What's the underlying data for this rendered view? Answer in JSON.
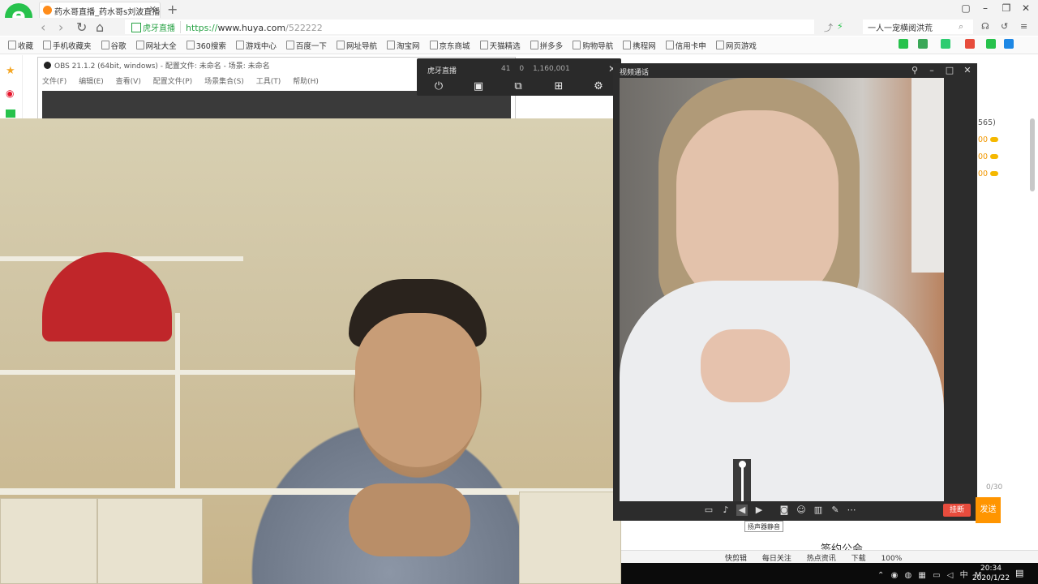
{
  "browser": {
    "tab_title": "药水哥直播_药水哥s刘波直播间",
    "tab_close": "✕",
    "new_tab": "+",
    "url_site_label": "虎牙直播",
    "url_protocol": "https://",
    "url_host": "www.huya.com",
    "url_path": "/522222",
    "search_text": "一人一宠横阅洪荒",
    "bookmarks": [
      "收藏",
      "手机收藏夹",
      "谷歌",
      "网址大全",
      "360搜索",
      "游戏中心",
      "百度一下",
      "网址导航",
      "淘宝网",
      "京东商城",
      "天猫精选",
      "拼多多",
      "购物导航",
      "携程网",
      "信用卡申",
      "网页游戏"
    ],
    "status_items": [
      "快剪辑",
      "每日关注",
      "热点资讯",
      "下载",
      "100%"
    ]
  },
  "obs": {
    "title": "OBS 21.1.2 (64bit, windows) - 配置文件: 未命名 - 场景: 未命名",
    "menu": [
      "文件(F)",
      "编辑(E)",
      "查看(V)",
      "配置文件(P)",
      "场景集合(S)",
      "工具(T)",
      "帮助(H)"
    ]
  },
  "huya_overlay": {
    "name": "虎牙直播",
    "stat_signal": "41",
    "stat_shares": "0",
    "stat_viewers": "1,160,001"
  },
  "video_call": {
    "title": "视频通话",
    "hangup_label": "挂断",
    "tooltip": "扬声器静音",
    "speaker_volume_pct": 100
  },
  "right_page": {
    "count_badge": "565)",
    "rows": [
      "00",
      "00",
      "00"
    ],
    "char_count": "0/30",
    "send_label": "发送",
    "signin_text": "签约公会"
  },
  "taskbar": {
    "ime": "中",
    "time": "20:34",
    "date": "2020/1/22"
  }
}
